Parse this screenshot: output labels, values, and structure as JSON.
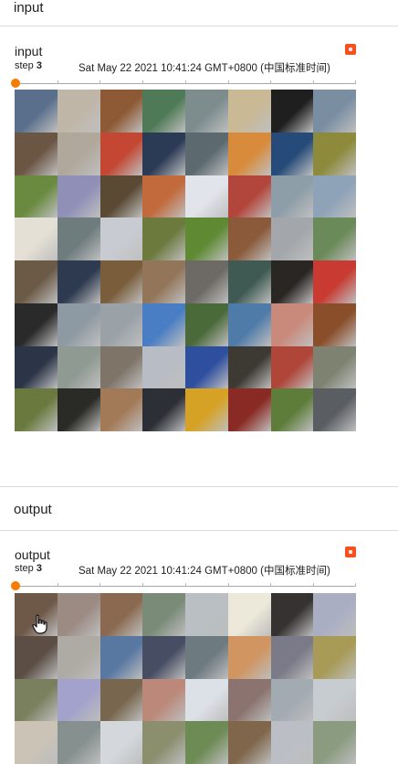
{
  "input_section": {
    "header": "input",
    "card": {
      "title": "input",
      "step_label": "step",
      "step_value": "3",
      "timestamp": "Sat May 22 2021 10:41:24 GMT+0800 (中国标准时间)",
      "slider": {
        "position": 0,
        "thumb_color": "#f57c00"
      },
      "expand_icon": "expand-icon",
      "tiles": [
        [
          "#5a6f8c",
          "#c0b6a8",
          "#8e5a36",
          "#4f7a57",
          "#7d8d8e",
          "#c9b995",
          "#1f1f1f",
          "#7a8ea2"
        ],
        [
          "#6b5644",
          "#b0a89b",
          "#c34732",
          "#2b3a55",
          "#5c6a70",
          "#d78b3b",
          "#264b7a",
          "#8d8a3c"
        ],
        [
          "#698a3f",
          "#8f8fb8",
          "#5a4a34",
          "#c26a3c",
          "#e1e4ea",
          "#b3463c",
          "#8e9ea8",
          "#8fa3b8"
        ],
        [
          "#e4e0d6",
          "#6f7c7e",
          "#c8ccd2",
          "#6c7a3e",
          "#5f8a33",
          "#8a5a3a",
          "#a3a7ab",
          "#6b8a59"
        ],
        [
          "#6b5a46",
          "#2d3a4f",
          "#7a5e3c",
          "#93765a",
          "#6d6a65",
          "#3f5a52",
          "#2a2624",
          "#c83a32"
        ],
        [
          "#2a2a2a",
          "#8e9aa3",
          "#9aa2a8",
          "#4a7ec4",
          "#4b6a3a",
          "#4f7ba8",
          "#c98a7c",
          "#8a4e2a"
        ],
        [
          "#2c3547",
          "#8f9a92",
          "#7e7468",
          "#b8bcc4",
          "#2e4f9e",
          "#3d3a33",
          "#b0463a",
          "#7d8370"
        ],
        [
          "#6a7a3e",
          "#2a2a26",
          "#a37a58",
          "#2d2f36",
          "#d6a225",
          "#8a2a24",
          "#5e7d3a",
          "#5a5e63"
        ]
      ]
    }
  },
  "output_section": {
    "header": "output",
    "card": {
      "title": "output",
      "step_label": "step",
      "step_value": "3",
      "timestamp": "Sat May 22 2021 10:41:24 GMT+0800 (中国标准时间)",
      "slider": {
        "position": 0,
        "thumb_color": "#f57c00"
      },
      "expand_icon": "expand-icon",
      "tiles": [
        [
          "#6f5a4a",
          "#9a8a82",
          "#8a6a52",
          "#7a8a78",
          "#b6bcc0",
          "#e8e4d6",
          "#3a3636",
          "#a8acc0"
        ],
        [
          "#5e5048",
          "#aca8a2",
          "#5a78a0",
          "#4a5064",
          "#6e7a80",
          "#cc9462",
          "#7a7a88",
          "#a69a5a"
        ],
        [
          "#7a8060",
          "#a0a0c8",
          "#786850",
          "#b8887a",
          "#d8dce2",
          "#8a7470",
          "#a0a8b0",
          "#c4c8cc"
        ],
        [
          "#c8c0b4",
          "#86908e",
          "#d0d4d8",
          "#8a8e6e",
          "#6e8a56",
          "#80684e",
          "#b8bcc2",
          "#8a9a80"
        ]
      ]
    }
  },
  "cursor": {
    "icon": "hand-pointer-icon"
  },
  "accent_color": "#f4511e"
}
